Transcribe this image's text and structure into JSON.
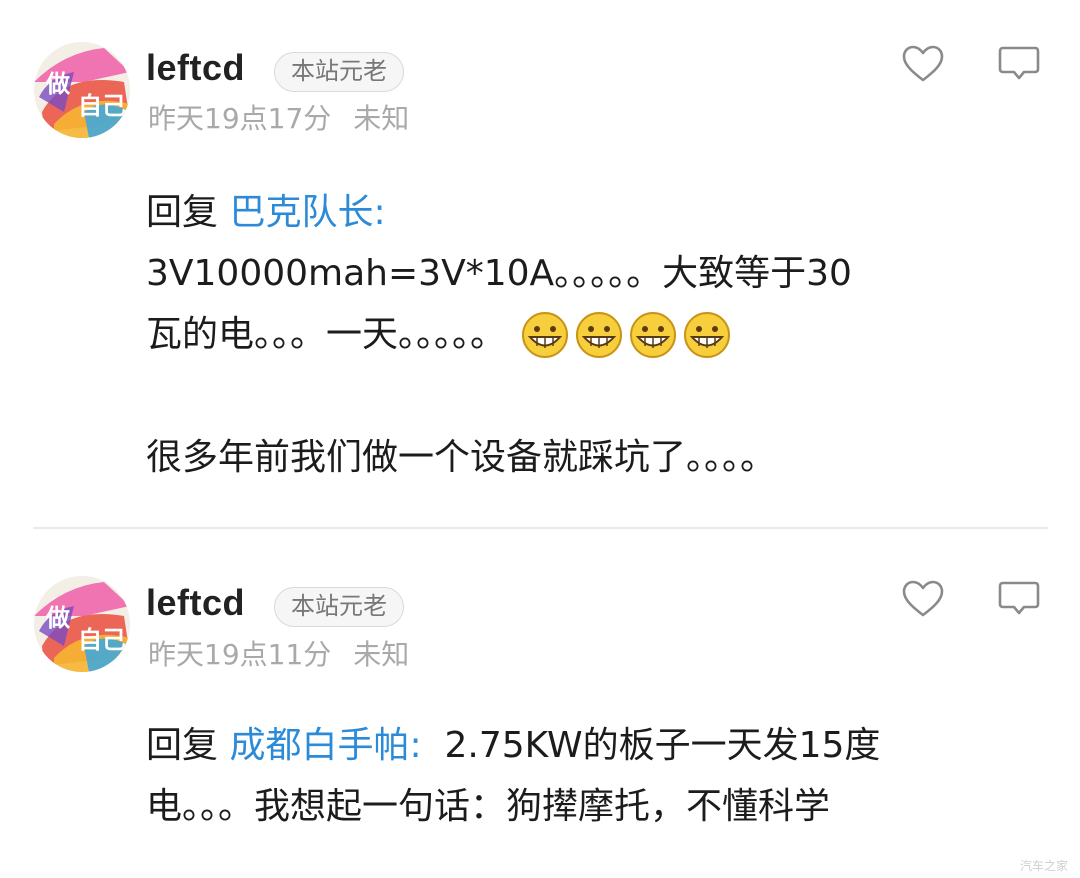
{
  "posts": [
    {
      "username": "leftcd",
      "badge": "本站元老",
      "time": "昨天19点17分",
      "location": "未知",
      "reply_prefix": "回复",
      "reply_target": "巴克队长:",
      "lines": [
        "3V10000mah=3V*10A。。。。。大致等于30",
        "瓦的电。。。一天。。。。。"
      ],
      "emoji_count": 4,
      "emoji_name": "grin-emoji",
      "after_blank": "很多年前我们做一个设备就踩坑了。。。。"
    },
    {
      "username": "leftcd",
      "badge": "本站元老",
      "time": "昨天19点11分",
      "location": "未知",
      "reply_prefix": "回复",
      "reply_target": "成都白手帕:",
      "first_line_rest": "  2.75KW的板子一天发15度",
      "lines": [
        "电。。。我想起一句话：狗撵摩托，不懂科学"
      ]
    }
  ],
  "icons": {
    "like": "heart-outline-icon",
    "reply": "comment-bubble-icon",
    "avatar": "avatar-logo"
  },
  "colors": {
    "link": "#2b8bd8",
    "meta": "#a9a9a9",
    "text": "#1c1c1c"
  },
  "watermark": "汽车之家"
}
